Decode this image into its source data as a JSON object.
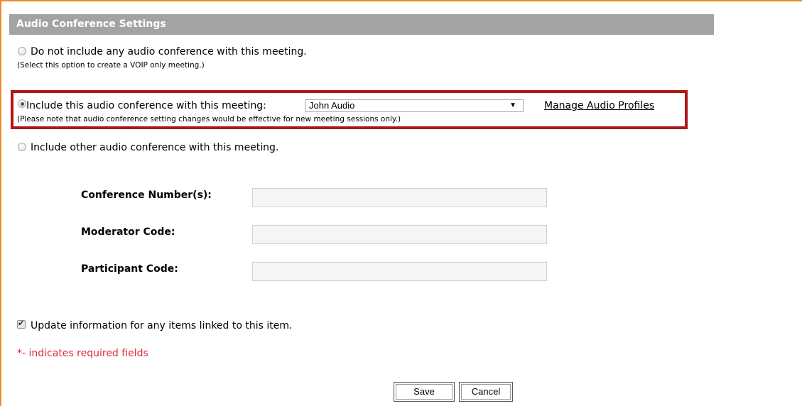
{
  "section": {
    "title": "Audio Conference Settings"
  },
  "options": {
    "no_audio": {
      "label": "Do not include any audio conference with this meeting.",
      "note": "(Select this option to create a VOIP only meeting.)",
      "selected": false
    },
    "this_audio": {
      "label": "Include this audio conference with this meeting:",
      "selected_profile": "John Audio",
      "manage_link": "Manage Audio Profiles",
      "note": "(Please note that audio conference setting changes would be effective for new meeting sessions only.)",
      "selected": true
    },
    "other_audio": {
      "label": "Include other audio conference with this meeting.",
      "selected": false
    }
  },
  "fields": {
    "conference_number": {
      "label": "Conference Number(s):",
      "value": ""
    },
    "moderator_code": {
      "label": "Moderator Code:",
      "value": ""
    },
    "participant_code": {
      "label": "Participant Code:",
      "value": ""
    }
  },
  "update_linked": {
    "label": "Update information for any items linked to this item.",
    "checked": true
  },
  "required_note": "*- indicates required fields",
  "buttons": {
    "save": "Save",
    "cancel": "Cancel"
  },
  "colors": {
    "header_bg": "#a3a3a3",
    "highlight_border": "#b01616",
    "frame_border": "#f08a24",
    "required_text": "#e0283a"
  }
}
